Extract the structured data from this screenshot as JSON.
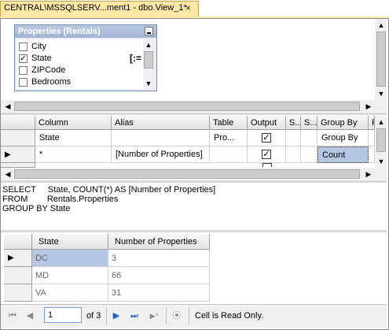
{
  "tab": {
    "title": "CENTRAL\\MSSQLSERV...ment1 - dbo.View_1*",
    "close_glyph": "×"
  },
  "diagram": {
    "table_title": "Properties (Rentals)",
    "fields": [
      {
        "label": "City",
        "checked": false
      },
      {
        "label": "State",
        "checked": true
      },
      {
        "label": "ZIPCode",
        "checked": false
      },
      {
        "label": "Bedrooms",
        "checked": false
      }
    ],
    "group_by_glyph": "[:="
  },
  "criteria_grid": {
    "headers": [
      "Column",
      "Alias",
      "Table",
      "Output",
      "S...",
      "S...",
      "Group By",
      "F"
    ],
    "rows": [
      {
        "column": "State",
        "alias": "",
        "table": "Pro...",
        "output": true,
        "group_by": "Group By"
      },
      {
        "column": "*",
        "alias": "[Number of Properties]",
        "table": "",
        "output": true,
        "group_by": "Count"
      }
    ],
    "check_glyph": "✓"
  },
  "sql": {
    "lines": [
      "SELECT     State, COUNT(*) AS [Number of Properties]",
      "FROM        Rentals.Properties",
      "GROUP BY State"
    ]
  },
  "results": {
    "headers": [
      "State",
      "Number of Properties"
    ],
    "rows": [
      {
        "state": "DC",
        "count": "3"
      },
      {
        "state": "MD",
        "count": "66"
      },
      {
        "state": "VA",
        "count": "31"
      }
    ]
  },
  "navigator": {
    "current_page": "1",
    "of_label": "of 3",
    "status": "Cell is Read Only."
  },
  "icons": {
    "first": "⏮",
    "prev": "◀",
    "next": "▶",
    "last": "⏭",
    "add": "▶*",
    "stop": "⦿",
    "row_indicator": "▶",
    "arrow_up": "▲",
    "arrow_down": "▼",
    "arrow_left": "◀",
    "arrow_right": "▶"
  },
  "colors": {
    "tab_bg": "#ffe8a6",
    "table_title_bg": "#9fb4d2",
    "selected_cell": "#b6c7e6",
    "nav_blue": "#1e5fbf"
  }
}
